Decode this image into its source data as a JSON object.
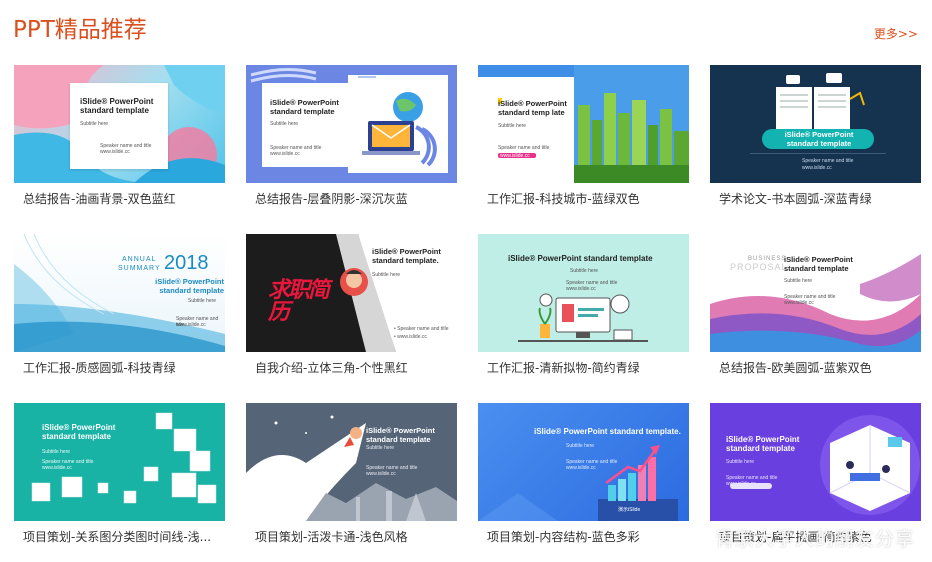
{
  "header": {
    "title": "PPT精品推荐",
    "more": "更多>>"
  },
  "cards": [
    {
      "caption": "总结报告-油画背景-双色蓝红",
      "title": "iSlide® PowerPoint standard template",
      "subtitle": "Subtitle here",
      "speaker": "Speaker name and title",
      "site": "www.islide.cc"
    },
    {
      "caption": "总结报告-层叠阴影-深沉灰蓝",
      "title": "iSlide® PowerPoint standard template",
      "subtitle": "Subtitle here",
      "speaker": "Speaker name and title",
      "site": "www.islide.cc"
    },
    {
      "caption": "工作汇报-科技城市-蓝绿双色",
      "title": "iSlide® PowerPoint standard temp late",
      "subtitle": "Subtitle here",
      "speaker": "Speaker name and title",
      "site": "www.islide.cc"
    },
    {
      "caption": "学术论文-书本圆弧-深蓝青绿",
      "title": "iSlide® PowerPoint standard template",
      "subtitle": "Subtitle here",
      "speaker": "Speaker name and title",
      "site": "www.islide.cc"
    },
    {
      "caption": "工作汇报-质感圆弧-科技青绿",
      "title": "iSlide® PowerPoint standard template",
      "subtitle": "Subtitle here",
      "annual": "ANNUAL",
      "summary": "SUMMARY",
      "year": "2018",
      "speaker": "Speaker name and title",
      "site": "www.islide.cc"
    },
    {
      "caption": "自我介绍-立体三角-个性黑红",
      "title": "iSlide® PowerPoint standard template.",
      "subtitle": "Subtitle here",
      "art": "求职简历",
      "speaker": "• Speaker name and title",
      "site": "• www.islide.cc"
    },
    {
      "caption": "工作汇报-清新拟物-简约青绿",
      "title": "iSlide® PowerPoint standard template",
      "subtitle": "Subtitle here",
      "speaker": "Speaker name and title",
      "site": "www.islide.cc"
    },
    {
      "caption": "总结报告-欧美圆弧-蓝紫双色",
      "title": "iSlide® PowerPoint standard template",
      "subtitle": "Subtitle here",
      "business": "BUSINESS",
      "proposal": "PROPOSAL",
      "speaker": "Speaker name and title",
      "site": "www.islide.cc"
    },
    {
      "caption": "项目策划-关系图分类图时间线-浅...",
      "title": "iSlide® PowerPoint standard template",
      "subtitle": "Subtitle here",
      "speaker": "Speaker name and title",
      "site": "www.islide.cc"
    },
    {
      "caption": "项目策划-活泼卡通-浅色风格",
      "title": "iSlide® PowerPoint standard template",
      "subtitle": "Subtitle here",
      "speaker": "Speaker name and title",
      "site": "www.islide.cc"
    },
    {
      "caption": "项目策划-内容结构-蓝色多彩",
      "title": "iSlide® PowerPoint standard template.",
      "subtitle": "Subtitle here",
      "speaker": "Speaker name and title",
      "site": "www.islide.cc",
      "badge": "演示iSlide"
    },
    {
      "caption": "项目策划-扁平插画-简约紫色",
      "title": "iSlide® PowerPoint standard template",
      "subtitle": "Subtitle here",
      "speaker": "Speaker name and title",
      "site": "www.islide.cc"
    }
  ],
  "watermark": "青京大学人的朋友分享",
  "colors": {
    "accent": "#d9501e",
    "caption": "#333333"
  }
}
